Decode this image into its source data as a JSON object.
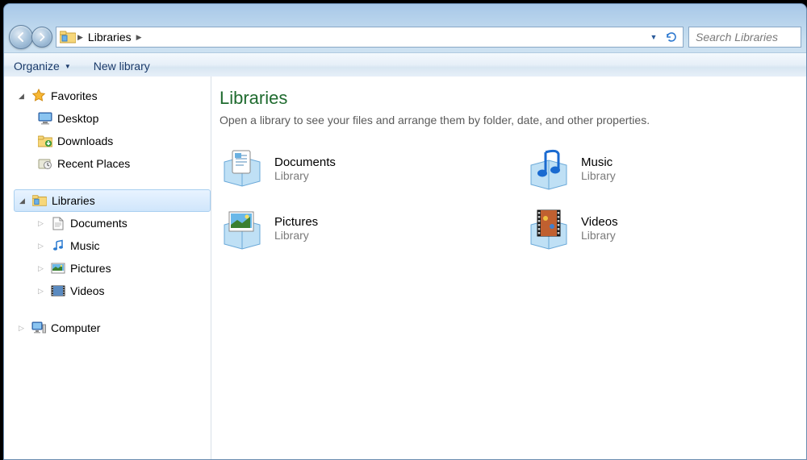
{
  "breadcrumb": {
    "location": "Libraries"
  },
  "search": {
    "placeholder": "Search Libraries"
  },
  "toolbar": {
    "organize": "Organize",
    "newlibrary": "New library"
  },
  "sidebar": {
    "favorites": {
      "label": "Favorites",
      "items": [
        {
          "label": "Desktop"
        },
        {
          "label": "Downloads"
        },
        {
          "label": "Recent Places"
        }
      ]
    },
    "libraries": {
      "label": "Libraries",
      "items": [
        {
          "label": "Documents"
        },
        {
          "label": "Music"
        },
        {
          "label": "Pictures"
        },
        {
          "label": "Videos"
        }
      ]
    },
    "computer": {
      "label": "Computer"
    }
  },
  "content": {
    "title": "Libraries",
    "subtitle": "Open a library to see your files and arrange them by folder, date, and other properties.",
    "libtype": "Library",
    "libs": [
      {
        "name": "Documents"
      },
      {
        "name": "Music"
      },
      {
        "name": "Pictures"
      },
      {
        "name": "Videos"
      }
    ]
  }
}
